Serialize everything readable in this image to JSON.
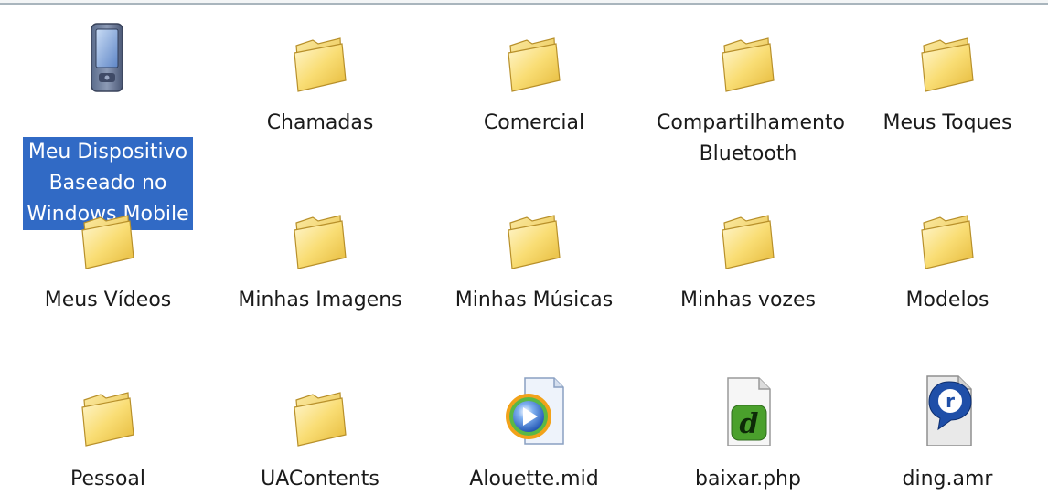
{
  "items": [
    {
      "label": "Meu Dispositivo\nBaseado no\nWindows Mobile",
      "icon": "pda-device-icon",
      "selected": true
    },
    {
      "label": "Chamadas",
      "icon": "folder-icon"
    },
    {
      "label": "Comercial",
      "icon": "folder-icon"
    },
    {
      "label": "Compartilhamento\nBluetooth",
      "icon": "folder-icon"
    },
    {
      "label": "Meus Toques",
      "icon": "folder-icon"
    },
    {
      "label": "Meus Vídeos",
      "icon": "folder-icon"
    },
    {
      "label": "Minhas Imagens",
      "icon": "folder-icon"
    },
    {
      "label": "Minhas Músicas",
      "icon": "folder-icon"
    },
    {
      "label": "Minhas vozes",
      "icon": "folder-icon"
    },
    {
      "label": "Modelos",
      "icon": "folder-icon"
    },
    {
      "label": "Pessoal",
      "icon": "folder-icon"
    },
    {
      "label": "UAContents",
      "icon": "folder-icon"
    },
    {
      "label": "Alouette.mid",
      "icon": "media-player-file-icon"
    },
    {
      "label": "baixar.php",
      "icon": "php-file-icon"
    },
    {
      "label": "ding.amr",
      "icon": "realplayer-file-icon"
    }
  ],
  "colors": {
    "selection": "#316ac5",
    "folder": "#f7d868"
  }
}
